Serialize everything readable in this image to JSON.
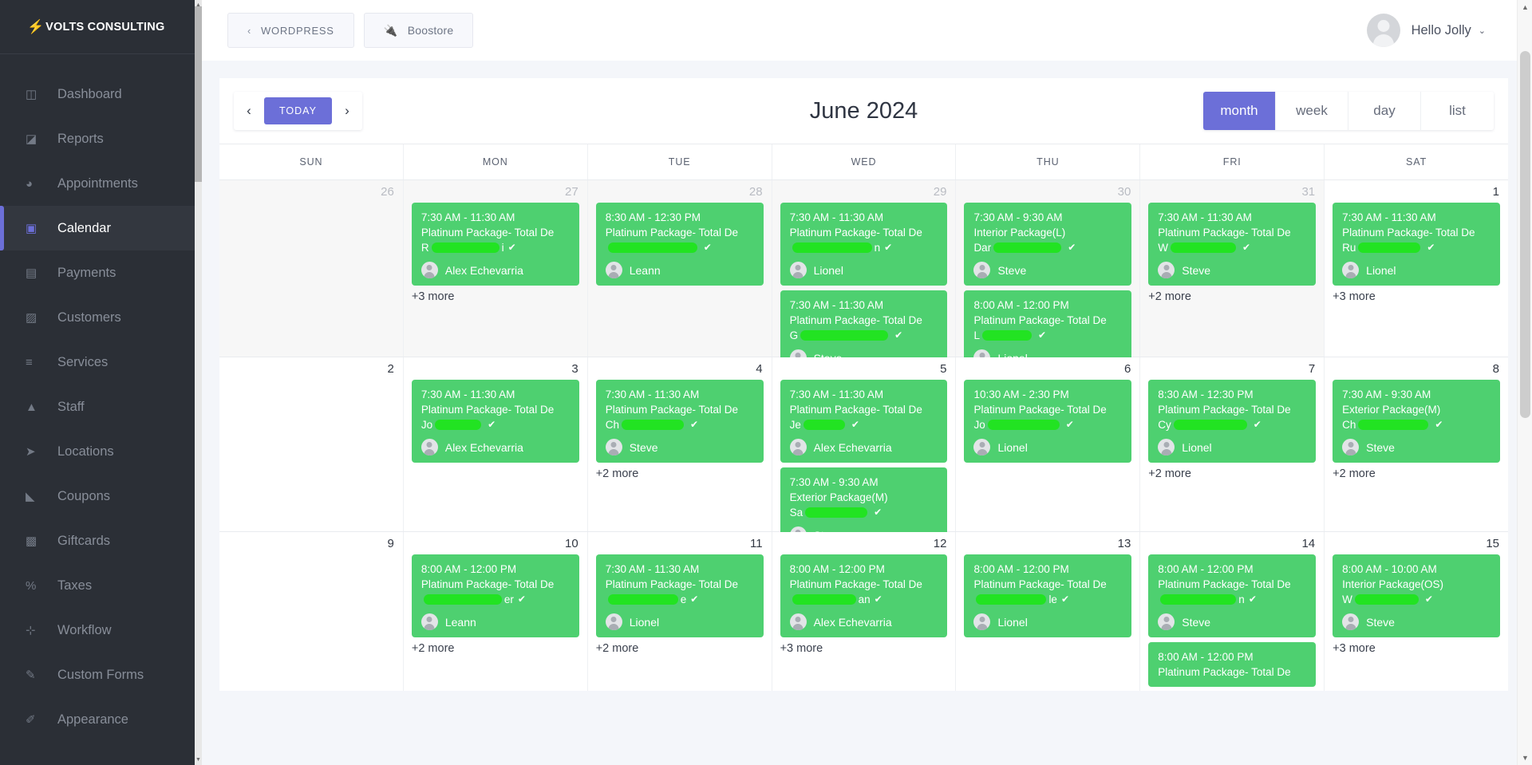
{
  "sidebar": {
    "brand": {
      "bolt": "⚡",
      "name": "VOLTS CONSULTING"
    },
    "items": [
      {
        "label": "Dashboard",
        "icon": "cube-icon",
        "glyph": "◫",
        "active": false
      },
      {
        "label": "Reports",
        "icon": "chart-icon",
        "glyph": "◪",
        "active": false
      },
      {
        "label": "Appointments",
        "icon": "clock-icon",
        "glyph": "◕",
        "active": false
      },
      {
        "label": "Calendar",
        "icon": "calendar-icon",
        "glyph": "▣",
        "active": true
      },
      {
        "label": "Payments",
        "icon": "wallet-icon",
        "glyph": "▤",
        "active": false
      },
      {
        "label": "Customers",
        "icon": "users-icon",
        "glyph": "▨",
        "active": false
      },
      {
        "label": "Services",
        "icon": "list-icon",
        "glyph": "≡",
        "active": false
      },
      {
        "label": "Staff",
        "icon": "person-icon",
        "glyph": "▲",
        "active": false
      },
      {
        "label": "Locations",
        "icon": "send-icon",
        "glyph": "➤",
        "active": false
      },
      {
        "label": "Coupons",
        "icon": "tag-icon",
        "glyph": "◣",
        "active": false
      },
      {
        "label": "Giftcards",
        "icon": "gift-icon",
        "glyph": "▩",
        "active": false
      },
      {
        "label": "Taxes",
        "icon": "percent-icon",
        "glyph": "%",
        "active": false
      },
      {
        "label": "Workflow",
        "icon": "workflow-icon",
        "glyph": "⊹",
        "active": false
      },
      {
        "label": "Custom Forms",
        "icon": "magicwand-icon",
        "glyph": "✎",
        "active": false
      },
      {
        "label": "Appearance",
        "icon": "paintbrush-icon",
        "glyph": "✐",
        "active": false
      }
    ]
  },
  "topbar": {
    "wordpress_label": "WORDPRESS",
    "wordpress_chevron": "‹",
    "boostore_label": "Boostore",
    "boostore_icon": "plugin-icon",
    "user_greeting": "Hello Jolly",
    "user_caret": "⌄"
  },
  "calendar": {
    "prev_label": "‹",
    "next_label": "›",
    "today_label": "TODAY",
    "title": "June 2024",
    "views": [
      {
        "label": "month",
        "active": true
      },
      {
        "label": "week",
        "active": false
      },
      {
        "label": "day",
        "active": false
      },
      {
        "label": "list",
        "active": false
      }
    ],
    "weekdays": [
      "SUN",
      "MON",
      "TUE",
      "WED",
      "THU",
      "FRI",
      "SAT"
    ],
    "weeks": [
      {
        "days": [
          {
            "num": "26",
            "other": true,
            "events": [],
            "more": ""
          },
          {
            "num": "27",
            "other": true,
            "events": [
              {
                "time": "7:30 AM - 11:30 AM",
                "package": "Platinum Package- Total De",
                "cust_prefix": "R",
                "cust_redact_w": 85,
                "cust_suffix": "i",
                "check": "✔",
                "staff": "Alex Echevarria"
              }
            ],
            "more": "+3 more"
          },
          {
            "num": "28",
            "other": true,
            "events": [
              {
                "time": "8:30 AM - 12:30 PM",
                "package": "Platinum Package- Total De",
                "cust_prefix": "",
                "cust_redact_w": 112,
                "cust_suffix": "",
                "check": "✔",
                "staff": "Leann"
              }
            ],
            "more": ""
          },
          {
            "num": "29",
            "other": true,
            "events": [
              {
                "time": "7:30 AM - 11:30 AM",
                "package": "Platinum Package- Total De",
                "cust_prefix": "",
                "cust_redact_w": 100,
                "cust_suffix": "n",
                "check": "✔",
                "staff": "Lionel"
              },
              {
                "time": "7:30 AM - 11:30 AM",
                "package": "Platinum Package- Total De",
                "cust_prefix": "G",
                "cust_redact_w": 110,
                "cust_suffix": "",
                "check": "✔",
                "staff": "Steve"
              }
            ],
            "more": ""
          },
          {
            "num": "30",
            "other": true,
            "events": [
              {
                "time": "7:30 AM - 9:30 AM",
                "package": "Interior Package(L)",
                "cust_prefix": "Dar",
                "cust_redact_w": 85,
                "cust_suffix": "",
                "check": "✔",
                "staff": "Steve"
              },
              {
                "time": "8:00 AM - 12:00 PM",
                "package": "Platinum Package- Total De",
                "cust_prefix": "L",
                "cust_redact_w": 62,
                "cust_suffix": "",
                "check": "✔",
                "staff": "Lionel"
              }
            ],
            "more": ""
          },
          {
            "num": "31",
            "other": true,
            "events": [
              {
                "time": "7:30 AM - 11:30 AM",
                "package": "Platinum Package- Total De",
                "cust_prefix": "W",
                "cust_redact_w": 82,
                "cust_suffix": "",
                "check": "✔",
                "staff": "Steve"
              }
            ],
            "more": "+2 more"
          },
          {
            "num": "1",
            "other": false,
            "events": [
              {
                "time": "7:30 AM - 11:30 AM",
                "package": "Platinum Package- Total De",
                "cust_prefix": "Ru",
                "cust_redact_w": 78,
                "cust_suffix": "",
                "check": "✔",
                "staff": "Lionel"
              }
            ],
            "more": "+3 more"
          }
        ]
      },
      {
        "days": [
          {
            "num": "2",
            "other": false,
            "events": [],
            "more": ""
          },
          {
            "num": "3",
            "other": false,
            "events": [
              {
                "time": "7:30 AM - 11:30 AM",
                "package": "Platinum Package- Total De",
                "cust_prefix": "Jo",
                "cust_redact_w": 58,
                "cust_suffix": "",
                "check": "✔",
                "staff": "Alex Echevarria"
              }
            ],
            "more": ""
          },
          {
            "num": "4",
            "other": false,
            "events": [
              {
                "time": "7:30 AM - 11:30 AM",
                "package": "Platinum Package- Total De",
                "cust_prefix": "Ch",
                "cust_redact_w": 78,
                "cust_suffix": "",
                "check": "✔",
                "staff": "Steve"
              }
            ],
            "more": "+2 more"
          },
          {
            "num": "5",
            "other": false,
            "events": [
              {
                "time": "7:30 AM - 11:30 AM",
                "package": "Platinum Package- Total De",
                "cust_prefix": "Je",
                "cust_redact_w": 52,
                "cust_suffix": "",
                "check": "✔",
                "staff": "Alex Echevarria"
              },
              {
                "time": "7:30 AM - 9:30 AM",
                "package": "Exterior Package(M)",
                "cust_prefix": "Sa",
                "cust_redact_w": 78,
                "cust_suffix": "",
                "check": "✔",
                "staff": "Steve"
              }
            ],
            "more": ""
          },
          {
            "num": "6",
            "other": false,
            "events": [
              {
                "time": "10:30 AM - 2:30 PM",
                "package": "Platinum Package- Total De",
                "cust_prefix": "Jo",
                "cust_redact_w": 90,
                "cust_suffix": "",
                "check": "✔",
                "staff": "Lionel"
              }
            ],
            "more": ""
          },
          {
            "num": "7",
            "other": false,
            "events": [
              {
                "time": "8:30 AM - 12:30 PM",
                "package": "Platinum Package- Total De",
                "cust_prefix": "Cy",
                "cust_redact_w": 92,
                "cust_suffix": "",
                "check": "✔",
                "staff": "Lionel"
              }
            ],
            "more": "+2 more"
          },
          {
            "num": "8",
            "other": false,
            "events": [
              {
                "time": "7:30 AM - 9:30 AM",
                "package": "Exterior Package(M)",
                "cust_prefix": "Ch",
                "cust_redact_w": 88,
                "cust_suffix": "",
                "check": "✔",
                "staff": "Steve"
              }
            ],
            "more": "+2 more"
          }
        ]
      },
      {
        "days": [
          {
            "num": "9",
            "other": false,
            "events": [],
            "more": ""
          },
          {
            "num": "10",
            "other": false,
            "events": [
              {
                "time": "8:00 AM - 12:00 PM",
                "package": "Platinum Package- Total De",
                "cust_prefix": "",
                "cust_redact_w": 98,
                "cust_suffix": "er",
                "check": "✔",
                "staff": "Leann"
              }
            ],
            "more": "+2 more"
          },
          {
            "num": "11",
            "other": false,
            "events": [
              {
                "time": "7:30 AM - 11:30 AM",
                "package": "Platinum Package- Total De",
                "cust_prefix": "",
                "cust_redact_w": 88,
                "cust_suffix": "e",
                "check": "✔",
                "staff": "Lionel"
              }
            ],
            "more": "+2 more"
          },
          {
            "num": "12",
            "other": false,
            "events": [
              {
                "time": "8:00 AM - 12:00 PM",
                "package": "Platinum Package- Total De",
                "cust_prefix": "",
                "cust_redact_w": 80,
                "cust_suffix": "an",
                "check": "✔",
                "staff": "Alex Echevarria"
              }
            ],
            "more": "+3 more"
          },
          {
            "num": "13",
            "other": false,
            "events": [
              {
                "time": "8:00 AM - 12:00 PM",
                "package": "Platinum Package- Total De",
                "cust_prefix": "",
                "cust_redact_w": 88,
                "cust_suffix": "le",
                "check": "✔",
                "staff": "Lionel"
              }
            ],
            "more": ""
          },
          {
            "num": "14",
            "other": false,
            "events": [
              {
                "time": "8:00 AM - 12:00 PM",
                "package": "Platinum Package- Total De",
                "cust_prefix": "",
                "cust_redact_w": 95,
                "cust_suffix": "n",
                "check": "✔",
                "staff": "Steve"
              },
              {
                "time": "8:00 AM - 12:00 PM",
                "package": "Platinum Package- Total De",
                "cust_prefix": "",
                "cust_redact_w": 0,
                "cust_suffix": "",
                "check": "",
                "staff": ""
              }
            ],
            "more": ""
          },
          {
            "num": "15",
            "other": false,
            "events": [
              {
                "time": "8:00 AM - 10:00 AM",
                "package": "Interior Package(OS)",
                "cust_prefix": "W",
                "cust_redact_w": 80,
                "cust_suffix": "",
                "check": "✔",
                "staff": "Steve"
              }
            ],
            "more": "+3 more"
          }
        ]
      }
    ]
  }
}
